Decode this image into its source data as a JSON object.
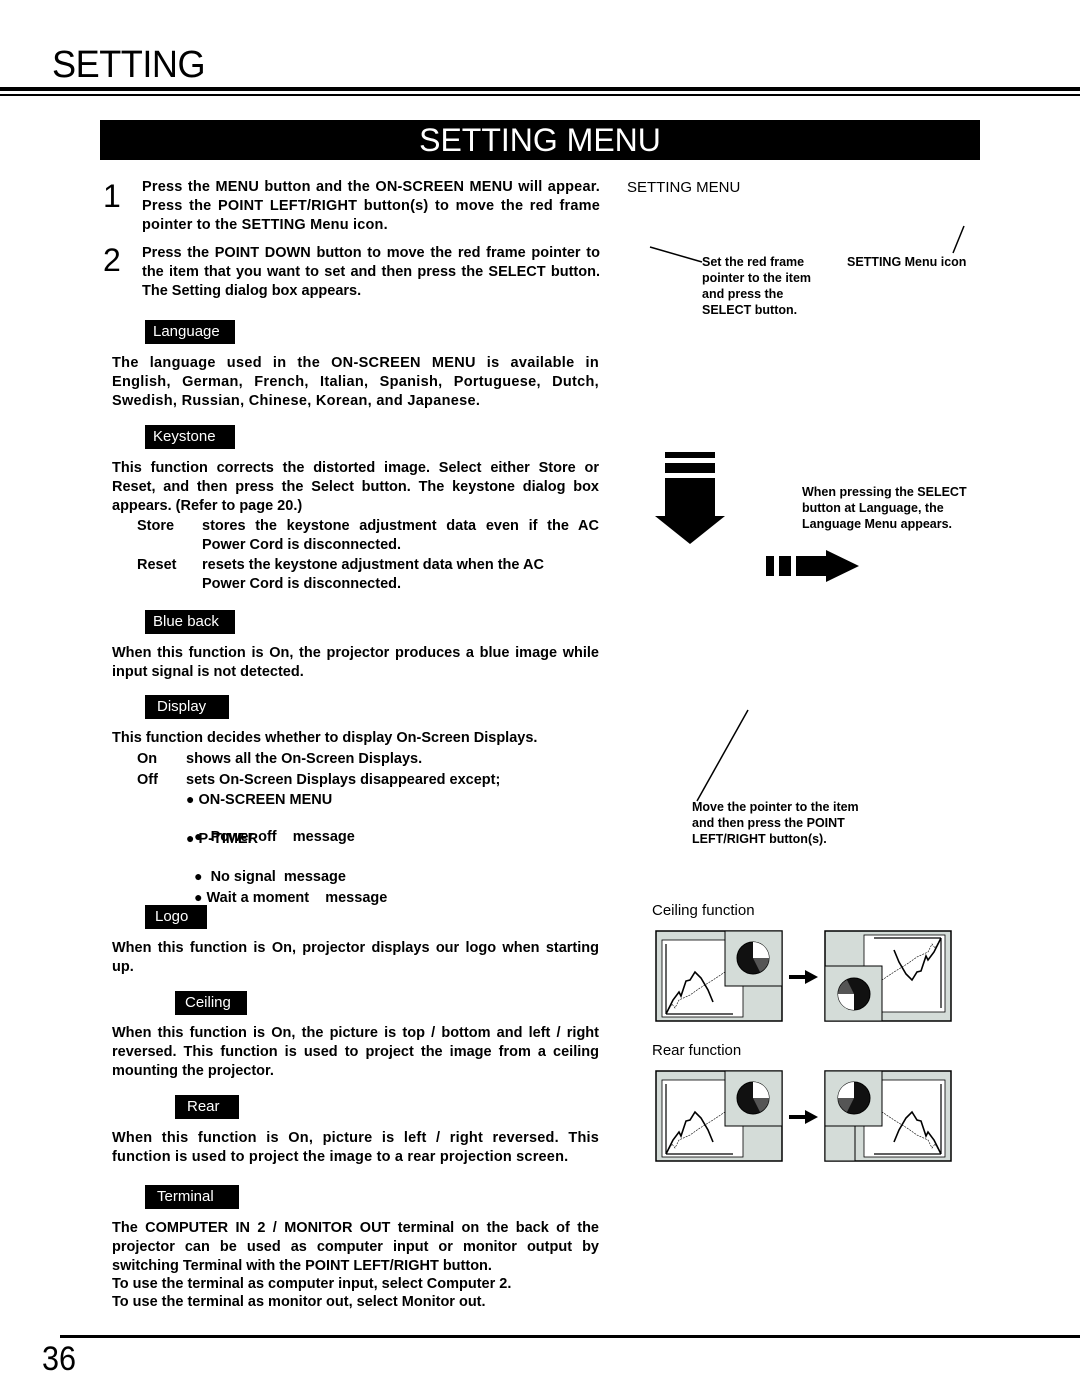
{
  "header": {
    "section_title": "SETTING",
    "banner_title": "SETTING MENU"
  },
  "steps": [
    {
      "num": "1",
      "text": "Press the MENU button and the ON-SCREEN MENU will appear.  Press the POINT LEFT/RIGHT button(s) to move the red frame pointer to the SETTING Menu icon."
    },
    {
      "num": "2",
      "text": "Press the POINT DOWN button to move the red frame pointer to the item that you want to set and then press the SELECT button. The Setting dialog box appears."
    }
  ],
  "sections": {
    "language": {
      "tag": "Language",
      "body": "The language used in the ON-SCREEN MENU is available in English, German, French, Italian, Spanish, Portuguese, Dutch, Swedish, Russian, Chinese, Korean, and Japanese."
    },
    "keystone": {
      "tag": "Keystone",
      "body": "This function corrects the distorted image.  Select either Store or Reset, and then press the Select button.  The keystone dialog box appears.  (Refer to page 20.)",
      "options": [
        {
          "label": "Store",
          "text": "stores the keystone adjustment data even if the AC Power Cord is disconnected."
        },
        {
          "label": "Reset",
          "text": "resets the keystone adjustment data when the AC Power Cord is disconnected."
        }
      ]
    },
    "blue_back": {
      "tag": "Blue back",
      "body": "When this function is  On,  the projector produces a blue image while input signal is not detected."
    },
    "display": {
      "tag": "Display",
      "body": "This function decides whether to display On-Screen Displays.",
      "options": [
        {
          "label": "On",
          "text": "shows all the On-Screen Displays."
        },
        {
          "label": "Off",
          "text": "sets On-Screen Displays disappeared except;"
        }
      ],
      "exceptions": [
        "ON-SCREEN MENU",
        "Power off    message",
        "P-TIMER",
        "No signal  message",
        "Wait a moment    message"
      ]
    },
    "logo": {
      "tag": "Logo",
      "body": "When this function is  On,  projector displays our logo when starting up."
    },
    "ceiling": {
      "tag": "Ceiling",
      "body": "When this function is  On,  the picture is top / bottom and left / right reversed.  This function is used to project the image from a ceiling mounting the  projector."
    },
    "rear": {
      "tag": "Rear",
      "body": "When this function is  On,  picture is left / right reversed.  This function is used to project the image to a rear projection screen."
    },
    "terminal": {
      "tag": "Terminal",
      "body": "The COMPUTER IN 2 / MONITOR OUT terminal on the back of the projector can be used as computer input or monitor output by switching Terminal with the POINT LEFT/RIGHT button.",
      "lines": [
        "To use the terminal as computer input, select Computer 2.",
        "To use the terminal as monitor out, select Monitor out."
      ]
    }
  },
  "right_column": {
    "setting_menu_caption": "SETTING MENU",
    "note_set_pointer": [
      "Set the red frame",
      "pointer to the item",
      "and press the",
      "SELECT button."
    ],
    "note_menu_icon": "SETTING Menu icon",
    "note_language": [
      "When pressing the SELECT",
      "button at Language, the",
      "Language Menu appears."
    ],
    "note_move_pointer": [
      "Move the pointer to the item",
      "and then press the POINT",
      "LEFT/RIGHT button(s)."
    ],
    "ceiling_caption": "Ceiling function",
    "rear_caption": "Rear function"
  },
  "footer": {
    "page_number": "36"
  },
  "colors": {
    "panel_gray": "#d4dcd8",
    "pie_dark_gray": "#555555"
  }
}
